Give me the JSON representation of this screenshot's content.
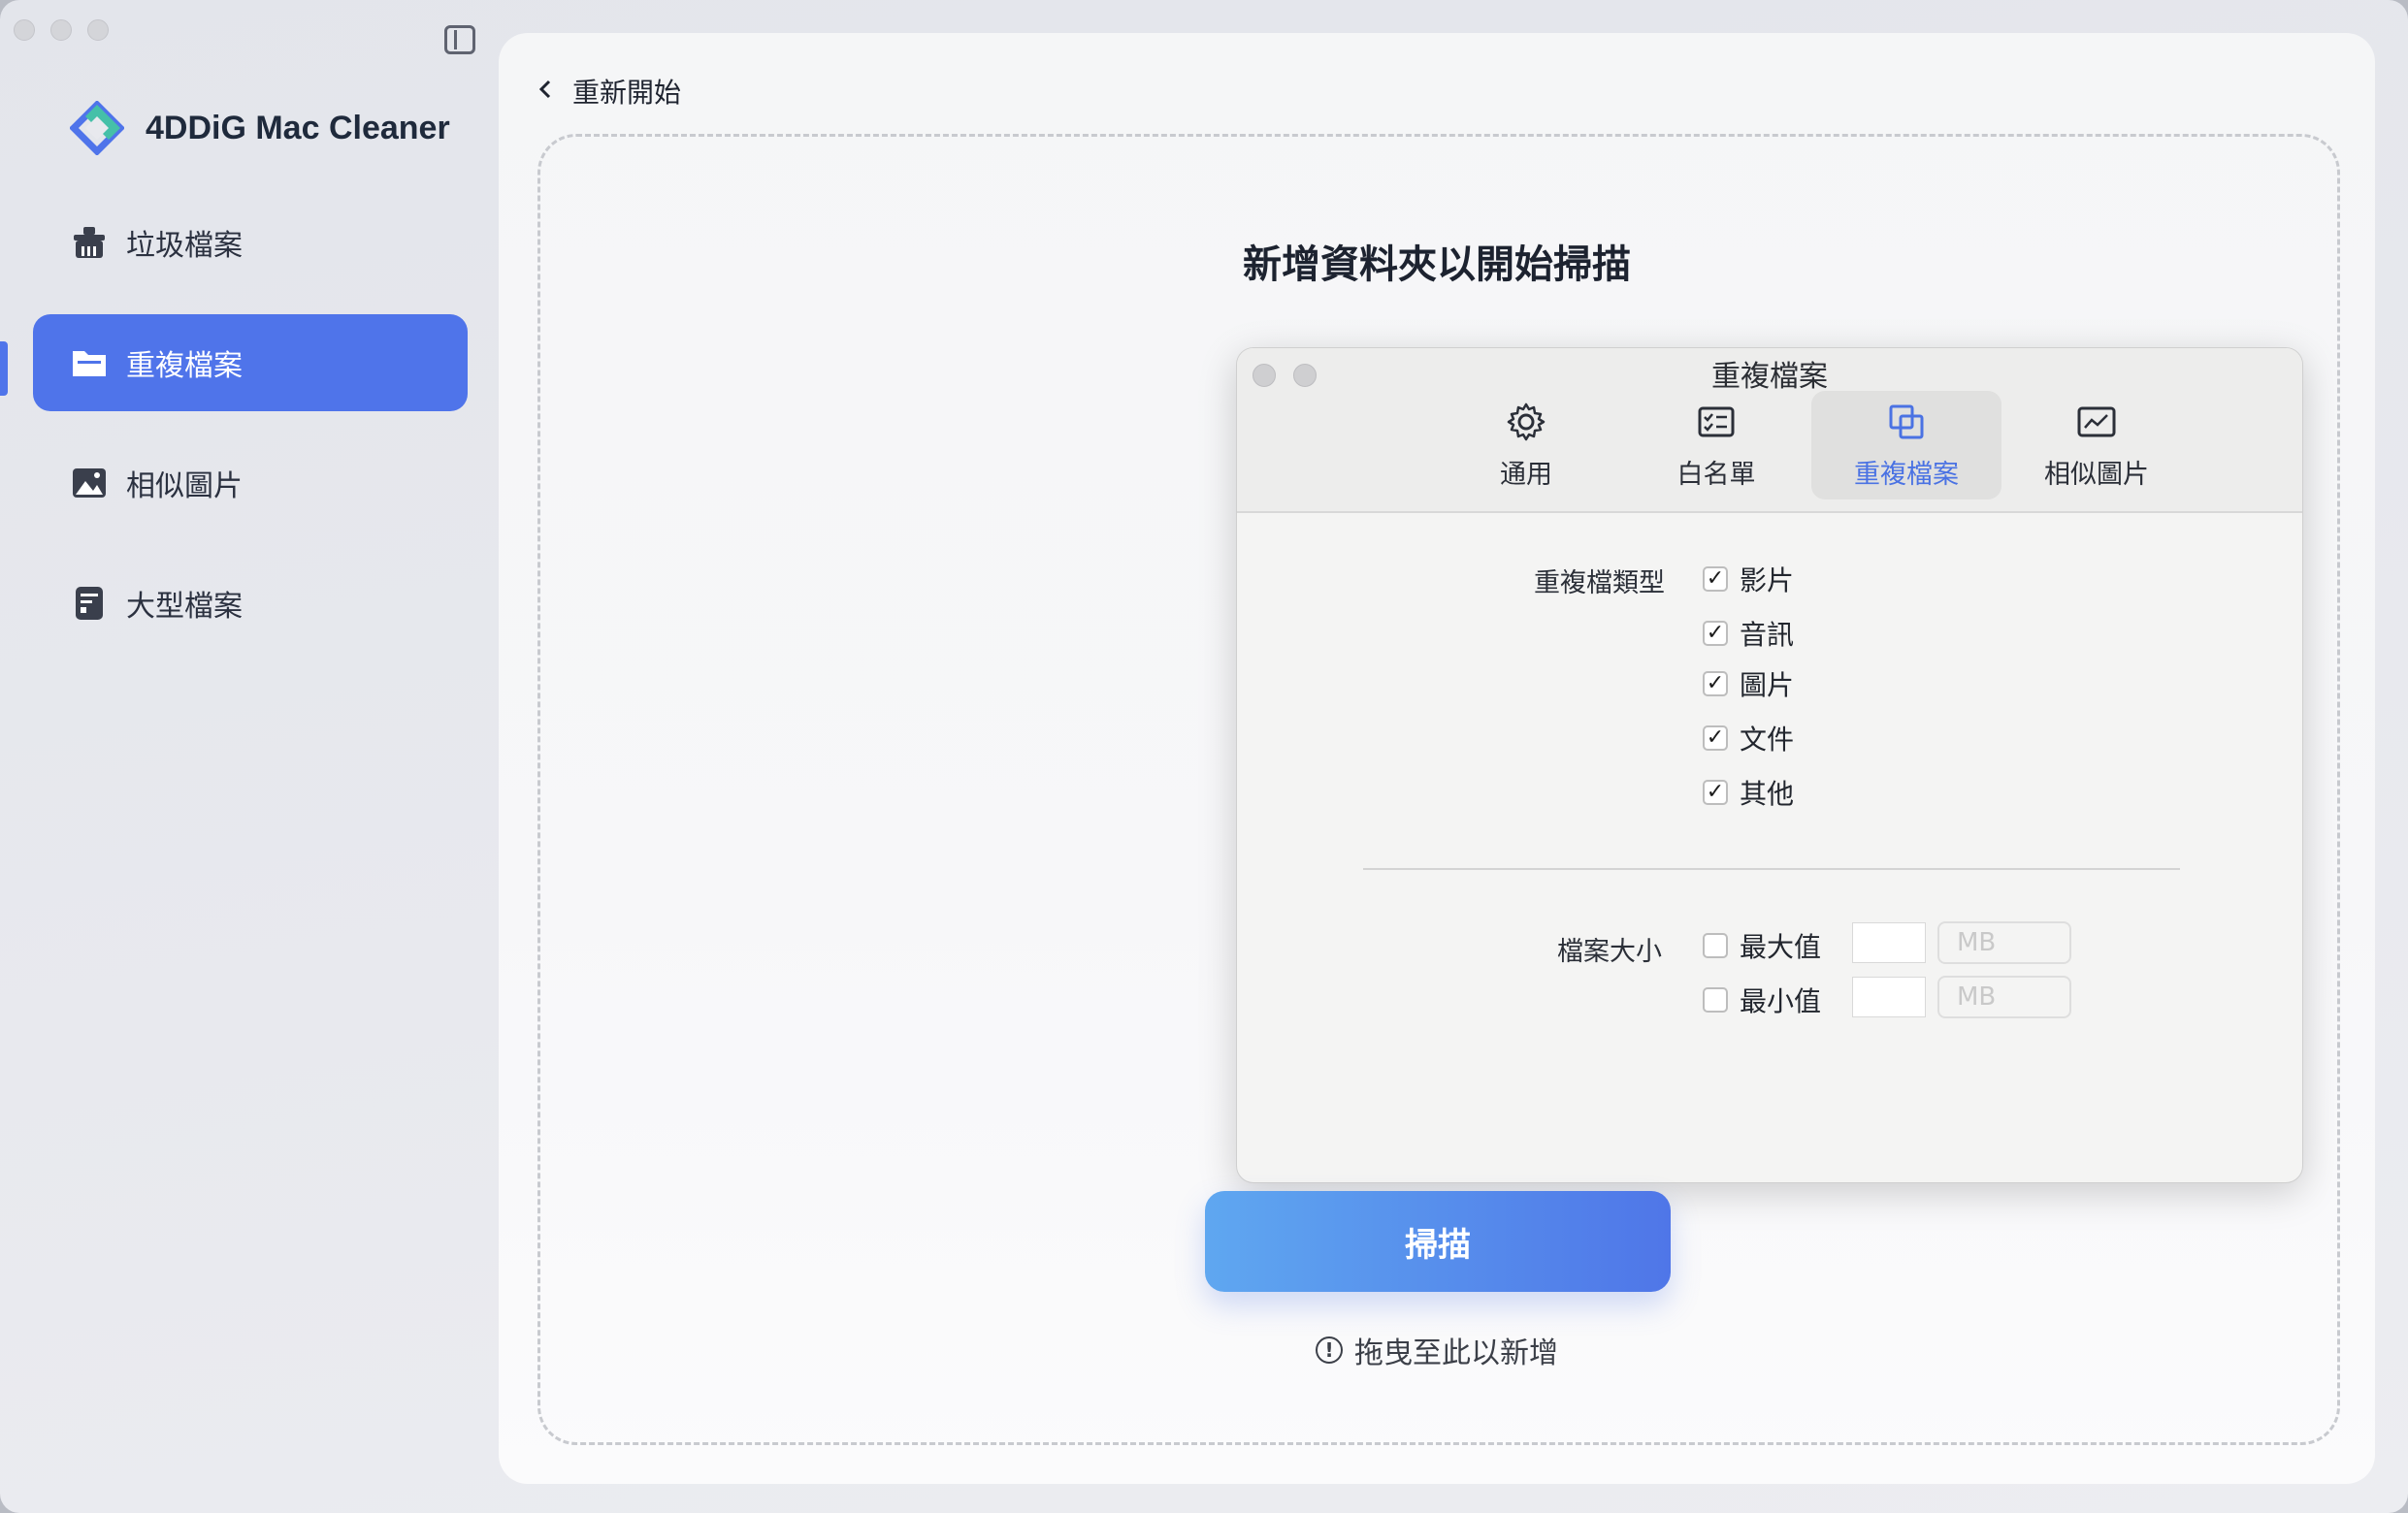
{
  "app": {
    "name": "4DDiG Mac Cleaner",
    "accent": "#4f74ea"
  },
  "sidebar": {
    "items": [
      {
        "label": "垃圾檔案",
        "icon": "trash-broom-icon"
      },
      {
        "label": "重複檔案",
        "icon": "folder-icon",
        "active": true
      },
      {
        "label": "相似圖片",
        "icon": "image-icon"
      },
      {
        "label": "大型檔案",
        "icon": "large-file-icon"
      }
    ]
  },
  "main": {
    "back_label": "重新開始",
    "drop_title": "新增資料夾以開始掃描",
    "scan_button": "掃描",
    "hint": "拖曳至此以新增"
  },
  "dialog": {
    "title": "重複檔案",
    "tabs": [
      {
        "label": "通用",
        "icon": "gear-icon"
      },
      {
        "label": "白名單",
        "icon": "checklist-icon"
      },
      {
        "label": "重複檔案",
        "icon": "duplicate-icon",
        "active": true
      },
      {
        "label": "相似圖片",
        "icon": "picture-icon"
      }
    ],
    "types_label": "重複檔類型",
    "types": [
      {
        "label": "影片",
        "checked": true
      },
      {
        "label": "音訊",
        "checked": true
      },
      {
        "label": "圖片",
        "checked": true
      },
      {
        "label": "文件",
        "checked": true
      },
      {
        "label": "其他",
        "checked": true
      }
    ],
    "size_label": "檔案大小",
    "size_rows": [
      {
        "label": "最大值",
        "checked": false,
        "value": "",
        "unit": "MB"
      },
      {
        "label": "最小值",
        "checked": false,
        "value": "",
        "unit": "MB"
      }
    ]
  }
}
